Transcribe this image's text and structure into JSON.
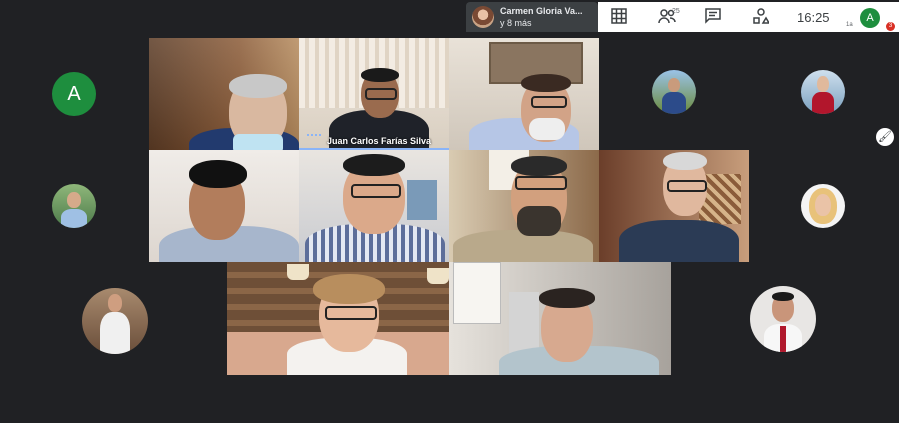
{
  "presenter": {
    "name": "Carmen Gloria Va...",
    "more": "y 8 más"
  },
  "toolbar": {
    "people_count": "25",
    "time": "16:25",
    "self_initial": "A",
    "self_sub": "1a",
    "notification_count": "3"
  },
  "grid": {
    "avatar_a_initial": "A",
    "active_speaker_name": "Juan Carlos Farías Silva"
  },
  "icons": [
    "grid-view-icon",
    "people-icon",
    "chat-icon",
    "activities-icon",
    "pin-icon"
  ],
  "colors": {
    "background": "#202124",
    "avatar_green": "#1e8e3e",
    "speaking_blue": "#8ab4f8"
  }
}
